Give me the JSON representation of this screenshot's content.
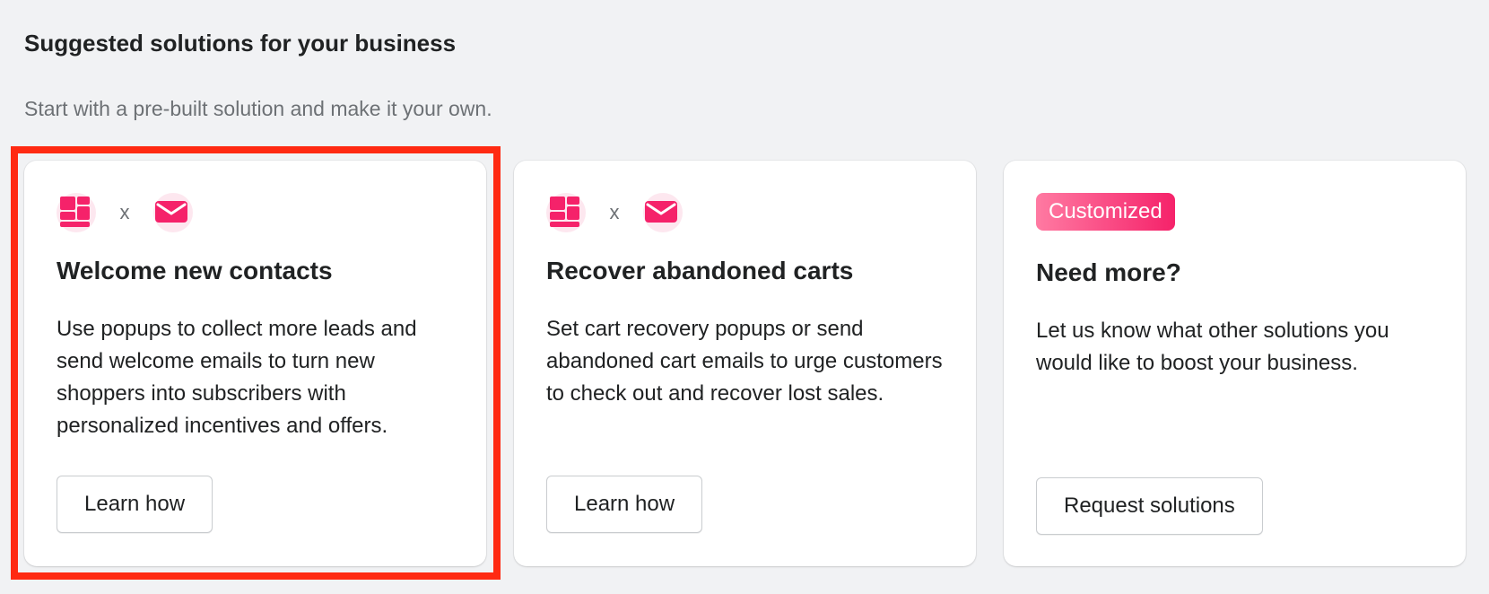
{
  "section": {
    "title": "Suggested solutions for your business",
    "subtitle": "Start with a pre-built solution and make it your own."
  },
  "cards": [
    {
      "icons": [
        "popup-icon",
        "email-icon"
      ],
      "separator": "x",
      "title": "Welcome new contacts",
      "description": "Use popups to collect more leads and send welcome emails to turn new shoppers into subscribers with personalized incentives and offers.",
      "button_label": "Learn how",
      "highlighted": true
    },
    {
      "icons": [
        "popup-icon",
        "email-icon"
      ],
      "separator": "x",
      "title": "Recover abandoned carts",
      "description": "Set cart recovery popups or send abandoned cart emails to urge customers to check out and recover lost sales.",
      "button_label": "Learn how"
    },
    {
      "badge": "Customized",
      "title": "Need more?",
      "description": "Let us know what other solutions you would like to boost your business.",
      "button_label": "Request solutions"
    }
  ],
  "colors": {
    "accent": "#f5226a",
    "highlight_border": "#ff2a12",
    "page_background": "#f1f2f4"
  }
}
